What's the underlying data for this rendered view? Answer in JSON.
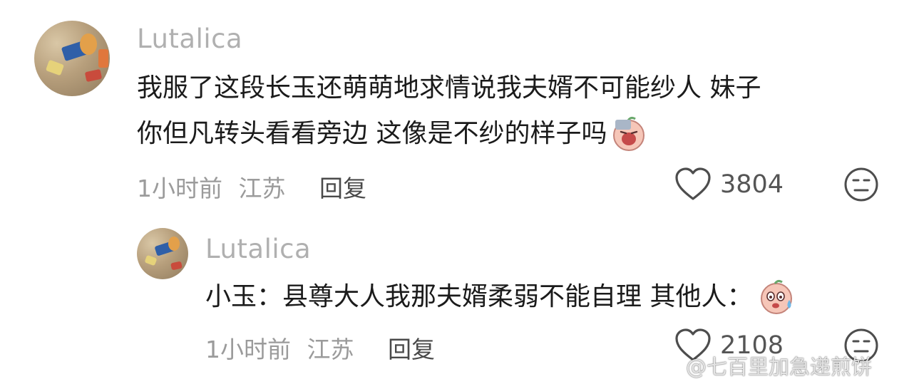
{
  "comments": [
    {
      "username": "Lutalica",
      "text_line1": "我服了这段长玉还萌萌地求情说我夫婿不可能纱人 妹子",
      "text_line2": "你但凡转头看看旁边 这像是不纱的样子吗",
      "emoji": "crying-face-emoji",
      "time": "1小时前",
      "location": "江苏",
      "reply_label": "回复",
      "like_count": "3804"
    },
    {
      "username": "Lutalica",
      "text_line1": "小玉：县尊大人我那夫婿柔弱不能自理 其他人：",
      "emoji": "sweating-face-emoji",
      "time": "1小时前",
      "location": "江苏",
      "reply_label": "回复",
      "like_count": "2108"
    }
  ],
  "watermark": "@七百里加急递煎饼",
  "icons": [
    "heart-icon",
    "dislike-face-icon",
    "weibo-logo-icon"
  ]
}
